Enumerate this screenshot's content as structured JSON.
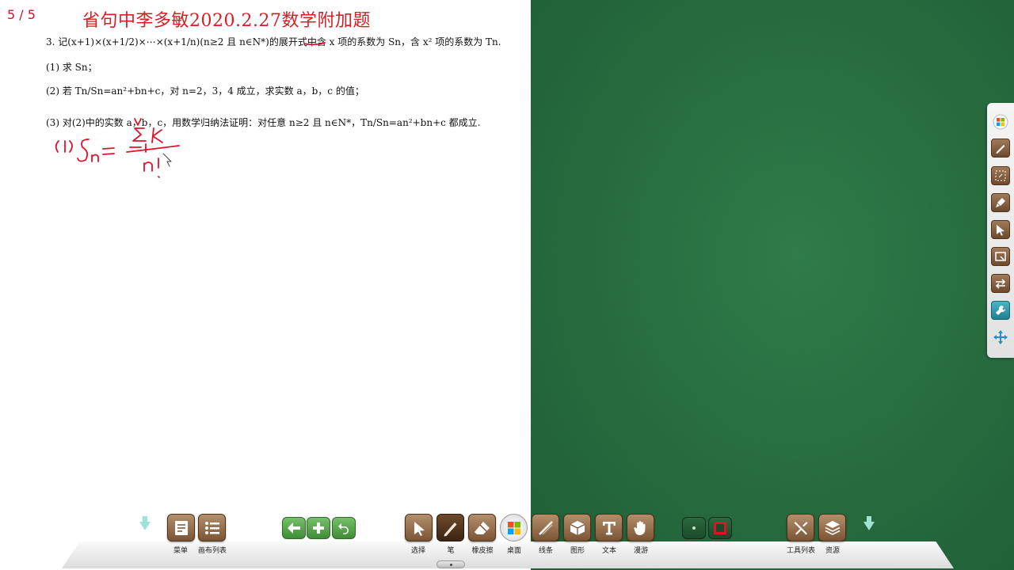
{
  "page": {
    "counter": "5 / 5",
    "title": "省句中李多敏2020.2.27数学附加题",
    "question": {
      "intro": "3. 记(x+1)×(x+1/2)×⋯×(x+1/n)(n≥2 且 n∈N*)的展开式中含 x 项的系数为 Sn，含 x² 项的系数为 Tn.",
      "part1": "(1) 求 Sn；",
      "part2": "(2) 若 Tn/Sn=an²+bn+c，对 n=2，3，4 成立，求实数 a，b，c 的值；",
      "part3": "(3) 对(2)中的实数 a，b，c，用数学归纳法证明：对任意 n≥2 且 n∈N*，Tn/Sn=an²+bn+c 都成立."
    },
    "ink_color": "#e3102a"
  },
  "right_toolbar": {
    "items": [
      {
        "icon": "windows-logo-icon"
      },
      {
        "icon": "pen-icon"
      },
      {
        "icon": "eraser-select-icon"
      },
      {
        "icon": "brush-icon"
      },
      {
        "icon": "pointer-icon"
      },
      {
        "icon": "screen-capture-icon"
      },
      {
        "icon": "swap-icon"
      },
      {
        "icon": "wrench-icon"
      },
      {
        "icon": "move-icon"
      }
    ]
  },
  "dock": {
    "menu_label": "菜单",
    "canvas_list_label": "画布列表",
    "select_label": "选择",
    "pen_label": "笔",
    "eraser_label": "橡皮擦",
    "desktop_label": "桌面",
    "line_label": "线条",
    "shape_label": "图形",
    "text_label": "文本",
    "roam_label": "漫游",
    "tools_label": "工具列表",
    "resources_label": "资源"
  },
  "colors": {
    "board": "#256a3d",
    "title_red": "#d21f26",
    "dock_brown": "#7a5434"
  }
}
